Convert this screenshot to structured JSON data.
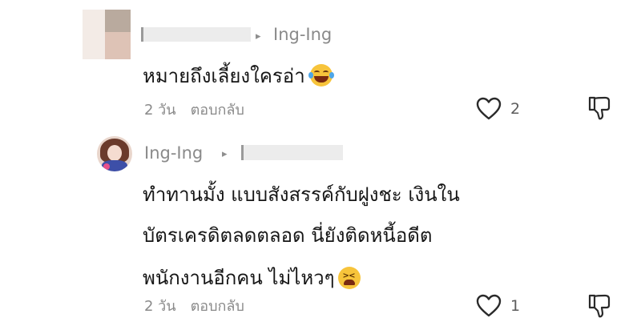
{
  "comments": [
    {
      "reply_to": "Ing-Ing",
      "text": "หมายถึงเลี้ยงใครอ่า",
      "emoji": "laughing-tears-emoji",
      "time": "2 วัน",
      "reply_label": "ตอบกลับ",
      "likes": "2"
    },
    {
      "author": "Ing-Ing",
      "lines": [
        "ทำทานมั้ง แบบสังสรรค์กับฝูงชะ เงินใน",
        "บัตรเครดิตลดตลอด นี่ยังติดหนี้อดีต",
        "พนักงานอีกคน ไม่ไหวๆ"
      ],
      "emoji": "tired-face-emoji",
      "time": "2 วัน",
      "reply_label": "ตอบกลับ",
      "likes": "1"
    }
  ],
  "icons": {
    "reply_arrow": "▸",
    "like": "heart-outline-icon",
    "dislike": "thumbs-down-icon"
  }
}
